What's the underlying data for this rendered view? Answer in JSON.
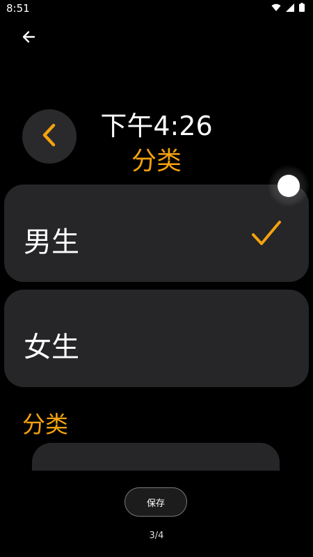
{
  "status_bar": {
    "time": "8:51"
  },
  "watch": {
    "time": "下午4:26",
    "title": "分类"
  },
  "options": [
    {
      "label": "男生",
      "selected": true
    },
    {
      "label": "女生",
      "selected": false
    }
  ],
  "section": {
    "label": "分类"
  },
  "footer": {
    "save_label": "保存",
    "page_indicator": "3/4"
  },
  "colors": {
    "accent": "#f5a20e",
    "card": "#262628",
    "background": "#000000"
  }
}
